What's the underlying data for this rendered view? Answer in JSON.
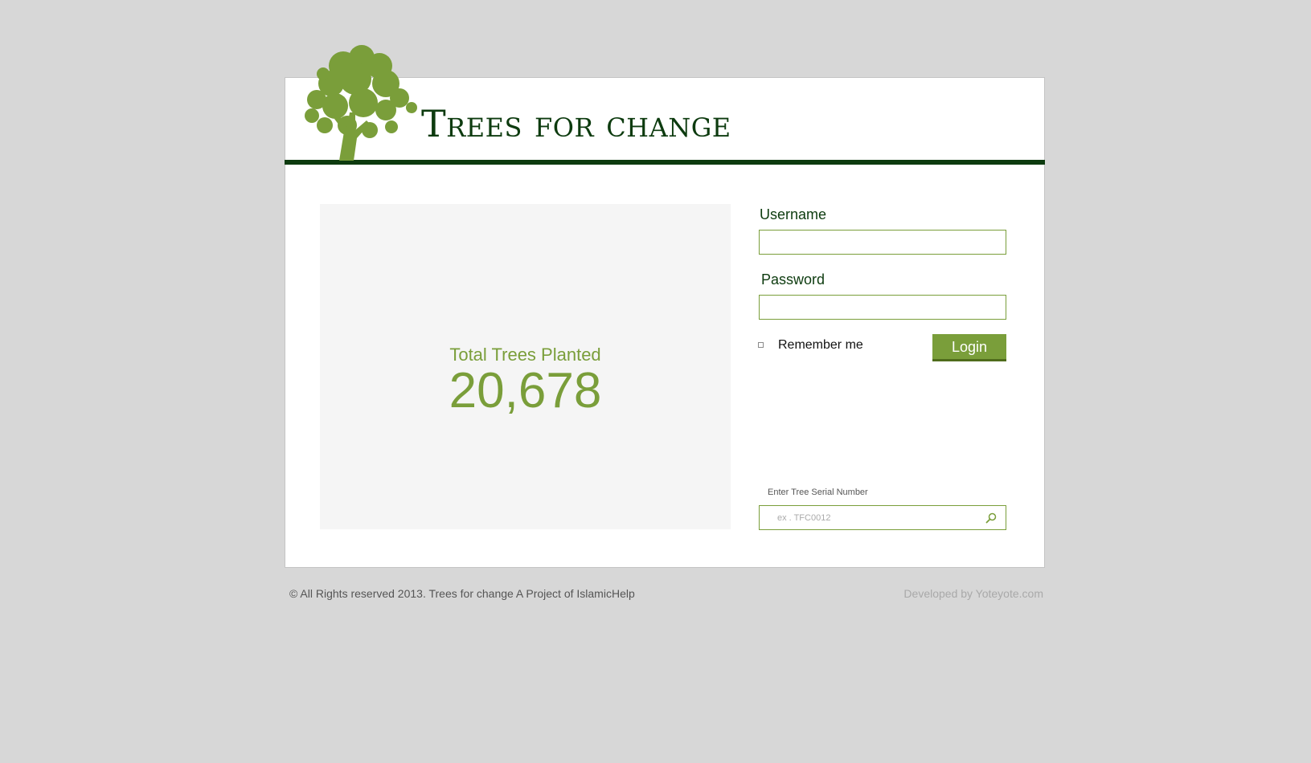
{
  "brand": {
    "title": "Trees for change",
    "logo_icon": "tree-icon"
  },
  "stats": {
    "label": "Total Trees Planted",
    "value": "20,678"
  },
  "login_form": {
    "username_label": "Username",
    "username_value": "",
    "password_label": "Password",
    "password_value": "",
    "remember_label": "Remember me",
    "remember_checked": false,
    "login_label": "Login"
  },
  "serial_search": {
    "label": "Enter Tree Serial Number",
    "placeholder": "ex . TFC0012",
    "icon": "search-icon"
  },
  "footer": {
    "copyright": "© All Rights reserved 2013. Trees for change A Project of IslamicHelp",
    "developer": "Developed by Yoteyote.com"
  },
  "colors": {
    "page_background": "#d7d7d7",
    "brand_dark_green": "#0d3b0f",
    "accent_green": "#7a9e3a",
    "panel_background": "#f5f5f5"
  }
}
